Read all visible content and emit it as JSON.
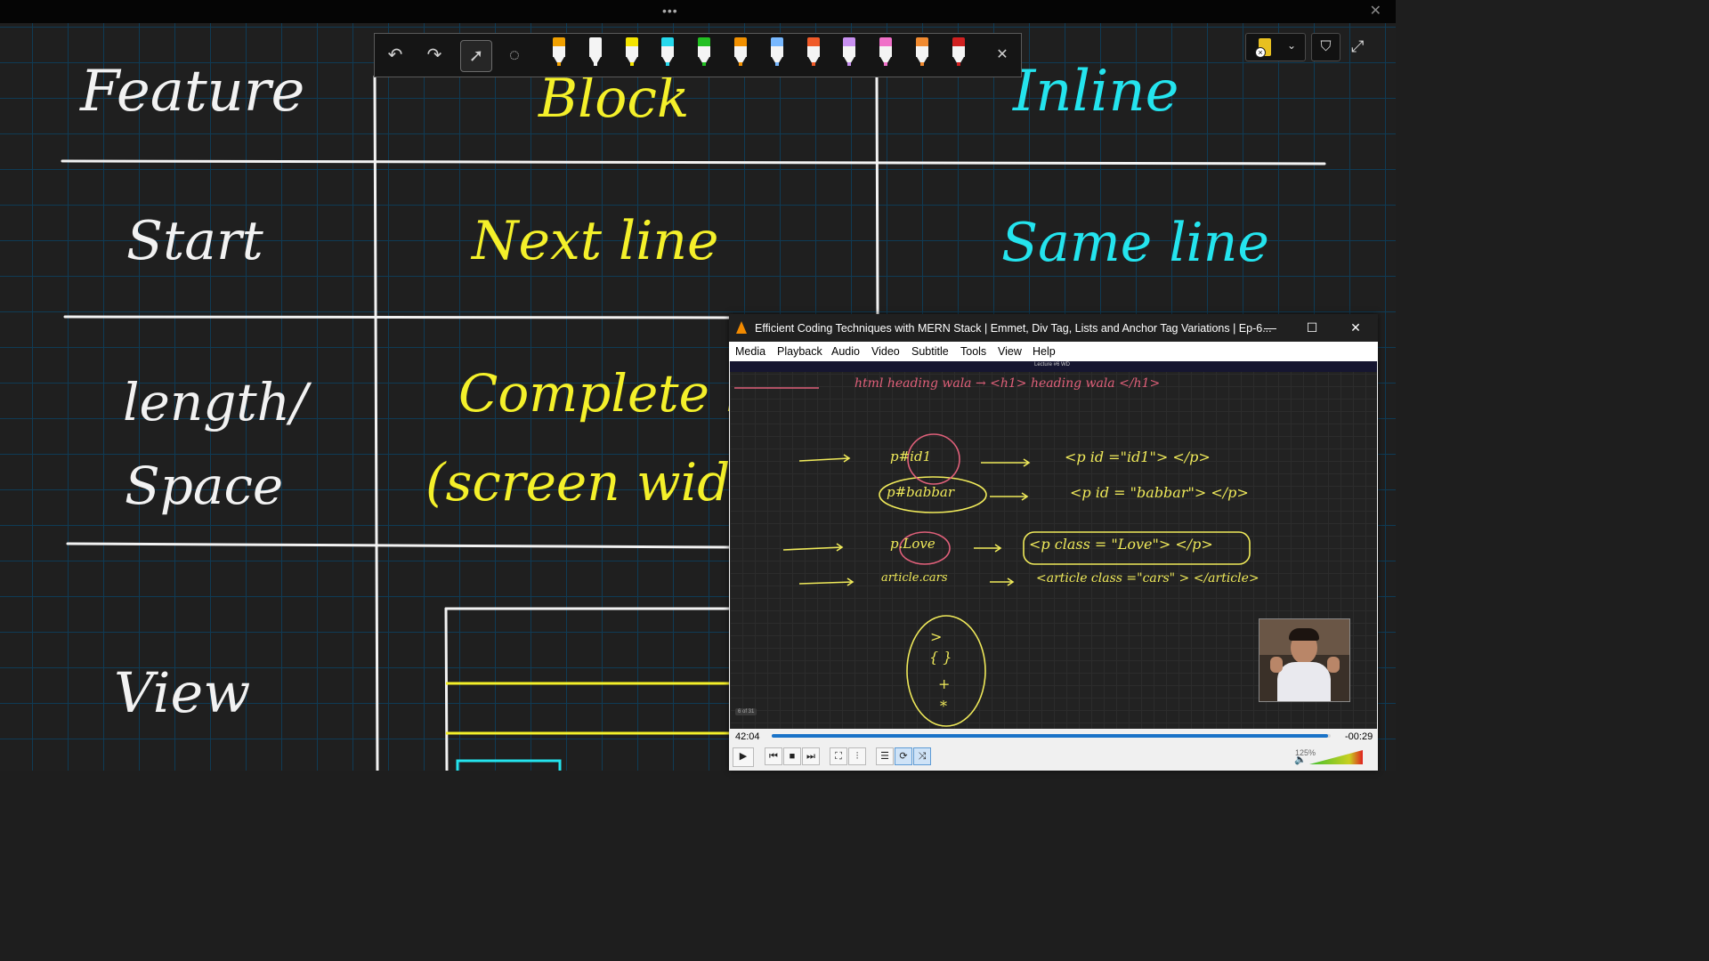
{
  "topbar": {
    "dots": "•••",
    "close": "✕"
  },
  "board": {
    "headings": [
      "Feature",
      "Block",
      "Inline"
    ],
    "rows": [
      {
        "feature": "Start",
        "block": "Next line",
        "inline": "Same line"
      },
      {
        "feature": "length/ Space",
        "block": "Complete line (screen width)",
        "inline": ""
      },
      {
        "feature": "View",
        "block": "",
        "inline": ""
      }
    ],
    "feature_line2": "Space"
  },
  "pen_toolbar": {
    "undo": "undo-icon",
    "redo": "redo-icon",
    "select": "cursor-icon",
    "lasso": "lasso-icon",
    "close": "✕",
    "pens": [
      "#f0a000",
      "#f4f4f4",
      "#f4e400",
      "#25d8ec",
      "#22c022",
      "#f19000",
      "#78b8ff",
      "#f05a28",
      "#c890f0",
      "#f070c8",
      "#f08a30",
      "#d02020"
    ]
  },
  "vlc": {
    "title": "Efficient Coding Techniques with MERN Stack | Emmet, Div Tag, Lists and Anchor Tag Variations | Ep-6...",
    "menu": [
      "Media",
      "Playback",
      "Audio",
      "Video",
      "Subtitle",
      "Tools",
      "View",
      "Help"
    ],
    "video": {
      "header": "Lecture #6 WD",
      "lines": [
        {
          "left": "p#id1",
          "right": "<p  id =\"id1\">  </p>"
        },
        {
          "left": "p#babbar",
          "right": "<p  id = \"babbar\">  </p>"
        },
        {
          "left": "p.Love",
          "right": "<p  class = \"Love\">  </p>"
        },
        {
          "left": "article.cars",
          "right": "<article  class =\"cars\" >  </article>"
        }
      ],
      "symbols": [
        ">",
        "{ }",
        "+",
        "*"
      ],
      "top_line": "html heading wala  →  <h1> heading  wala </h1>",
      "page_indicator": "6 of 31"
    },
    "elapsed": "42:04",
    "remaining": "-00:29",
    "progress": 0.995,
    "volume": "125%"
  },
  "colors": {
    "white_ink": "#f2f2f2",
    "yellow_ink": "#f4f02a",
    "cyan_ink": "#24e4ee",
    "grid": "#0f3b55"
  }
}
